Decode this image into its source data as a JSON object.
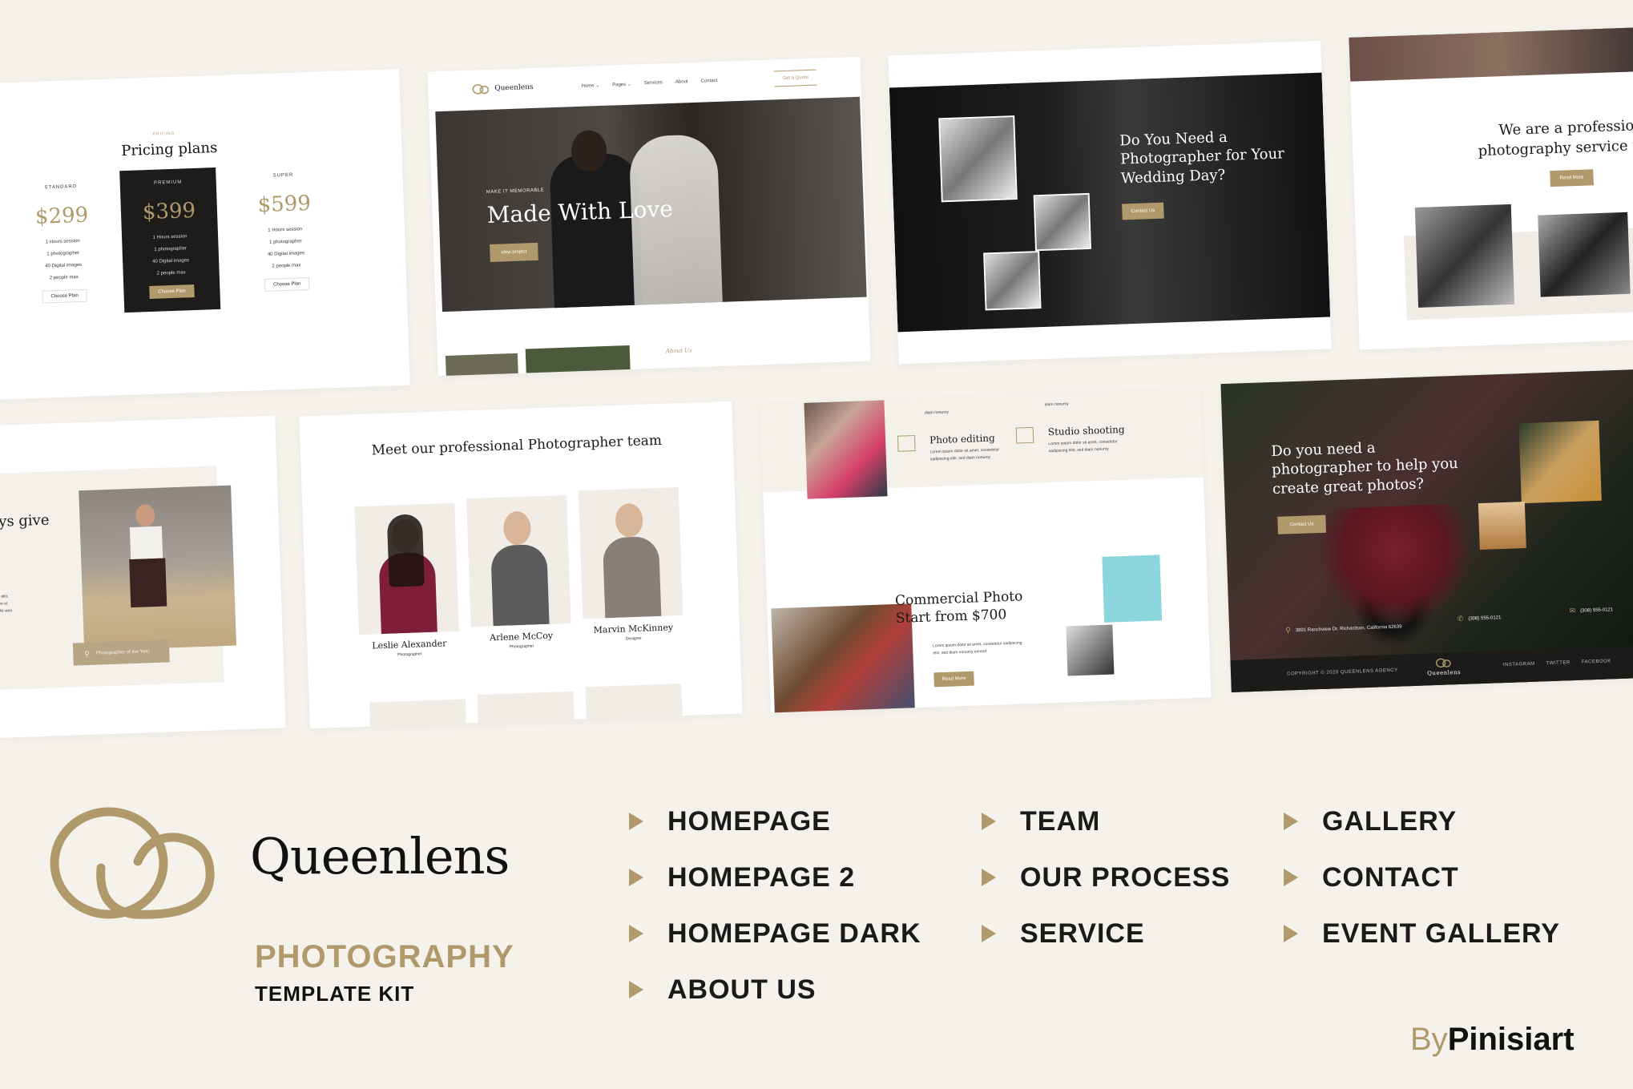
{
  "colors": {
    "accent": "#b09a6c",
    "background": "#f5f2ec",
    "dark": "#1e1c1a"
  },
  "pricing": {
    "kicker": "PRICING",
    "title": "Pricing plans",
    "plans": [
      {
        "name": "STANDARD",
        "price": "$299",
        "features": [
          "1 Hours session",
          "1 photographer",
          "40 Digital images",
          "2 people max"
        ],
        "cta": "Choose Plan"
      },
      {
        "name": "PREMIUM",
        "price": "$399",
        "features": [
          "1 Hours session",
          "1 photographer",
          "40 Digital images",
          "2 people max"
        ],
        "cta": "Choose Plan"
      },
      {
        "name": "SUPER",
        "price": "$599",
        "features": [
          "1 Hours session",
          "1 photographer",
          "40 Digital images",
          "2 people max"
        ],
        "cta": "Choose Plan"
      }
    ]
  },
  "homepage": {
    "brand": "Queenlens",
    "nav": [
      "Home ⌄",
      "Pages ⌄",
      "Services",
      "About",
      "Contact"
    ],
    "quote_button": "Get a Quote",
    "hero_kicker": "MAKE IT MEMORABLE",
    "hero_title": "Made With Love",
    "hero_button": "view project",
    "script_text": "About Us"
  },
  "wedding_cta": {
    "title": "Do You Need a Photographer for Your Wedding Day?",
    "button": "Contact Us"
  },
  "about": {
    "title": "We are a professional photography service pro",
    "button": "Read More"
  },
  "about2": {
    "title": "ays give",
    "body_lines": [
      "cing elitr,",
      "abore et",
      "uo. At vero"
    ],
    "badge": "Photographer of the Year"
  },
  "team": {
    "title": "Meet our professional Photographer team",
    "members": [
      {
        "name": "Leslie Alexander",
        "role": "Photographer"
      },
      {
        "name": "Arlene McCoy",
        "role": "Photographer"
      },
      {
        "name": "Marvin McKinney",
        "role": "Designer"
      }
    ]
  },
  "services": {
    "top_text_1": "diam nonumy",
    "top_text_2": "diam nonumy",
    "items": [
      {
        "name": "Photo editing",
        "text": "Lorem ipsum dolor sit amet, consetetur sadipscing elitr, sed diam nonumy"
      },
      {
        "name": "Studio shooting",
        "text": "Lorem ipsum dolor sit amet, consetetur sadipscing elitr, sed diam nonumy"
      }
    ],
    "commercial_title": "Commercial Photo Start from $700",
    "commercial_text": "Lorem ipsum dolor sit amet, consetetur sadipscing elitr, sed diam nonumy eirmod",
    "button": "Read More"
  },
  "contact_page": {
    "title": "Do you need a photographer to help you create great photos?",
    "button": "Contact Us",
    "address": "3891 Ranchview Dr. Richardson, California 62639",
    "phone": "(308) 555-0121",
    "email": "(308) 555-0121",
    "copyright": "COPYRIGHT © 2020 QUEENLENS AGENCY",
    "footer_brand": "Queenlens",
    "social": [
      "INSTAGRAM",
      "TWITTER",
      "FACEBOOK"
    ]
  },
  "brand": {
    "name": "Queenlens",
    "subtitle": "PHOTOGRAPHY",
    "subtitle2": "TEMPLATE KIT"
  },
  "pages": {
    "col1": [
      "HOMEPAGE",
      "HOMEPAGE 2",
      "HOMEPAGE DARK",
      "ABOUT US"
    ],
    "col2": [
      "TEAM",
      "OUR PROCESS",
      "SERVICE"
    ],
    "col3": [
      "GALLERY",
      "CONTACT",
      "EVENT GALLERY"
    ]
  },
  "byline": {
    "by": "By",
    "author": "Pinisiart"
  }
}
